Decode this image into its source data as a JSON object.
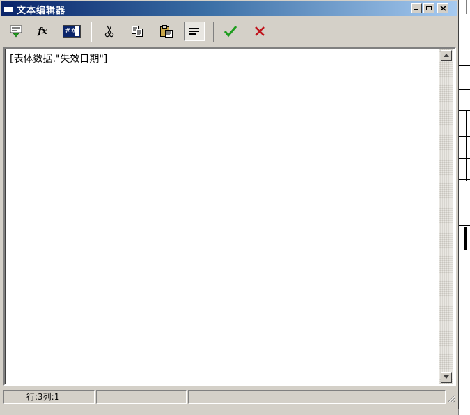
{
  "window": {
    "title": "文本编辑器",
    "controls": {
      "minimize": "minimize",
      "maximize": "maximize",
      "close": "close"
    }
  },
  "toolbar": {
    "buttons": [
      {
        "id": "insert-field",
        "icon": "insert-field-icon"
      },
      {
        "id": "function",
        "icon": "function-icon",
        "label": "fx"
      },
      {
        "id": "format-number",
        "icon": "number-format-icon",
        "label": "##"
      },
      {
        "id": "cut",
        "icon": "scissors-icon"
      },
      {
        "id": "copy",
        "icon": "copy-icon"
      },
      {
        "id": "paste",
        "icon": "paste-icon"
      },
      {
        "id": "word-wrap",
        "icon": "align-lines-icon",
        "active": true
      },
      {
        "id": "ok",
        "icon": "checkmark-icon"
      },
      {
        "id": "cancel",
        "icon": "x-icon"
      }
    ]
  },
  "editor": {
    "line1": "[表体数据.\"失效日期\"]",
    "line2": "",
    "line3": ""
  },
  "statusbar": {
    "position": "行:3列:1",
    "cell2": "",
    "cell3": ""
  },
  "colors": {
    "titlebar_start": "#0a246a",
    "titlebar_end": "#a6caf0",
    "ok_green": "#1f9e1f",
    "cancel_red": "#c0141c",
    "chrome": "#d4d0c8"
  }
}
